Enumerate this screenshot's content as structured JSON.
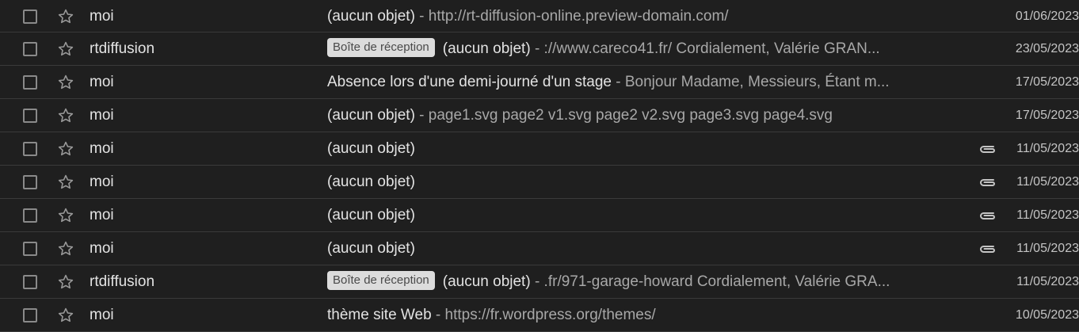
{
  "emails": [
    {
      "sender": "moi",
      "badge": "",
      "subject": "(aucun objet)",
      "snippet": " - http://rt-diffusion-online.preview-domain.com/",
      "attachment": false,
      "date": "01/06/2023"
    },
    {
      "sender": "rtdiffusion",
      "badge": "Boîte de réception",
      "subject": "(aucun objet)",
      "snippet": " - ://www.careco41.fr/ Cordialement, Valérie GRAN...",
      "attachment": false,
      "date": "23/05/2023"
    },
    {
      "sender": "moi",
      "badge": "",
      "subject": "Absence lors d'une demi-journé d'un stage",
      "snippet": " - Bonjour Madame, Messieurs, Étant m...",
      "attachment": false,
      "date": "17/05/2023"
    },
    {
      "sender": "moi",
      "badge": "",
      "subject": "(aucun objet)",
      "snippet": " - page1.svg page2 v1.svg page2 v2.svg page3.svg page4.svg",
      "attachment": false,
      "date": "17/05/2023"
    },
    {
      "sender": "moi",
      "badge": "",
      "subject": "(aucun objet)",
      "snippet": "",
      "attachment": true,
      "date": "11/05/2023"
    },
    {
      "sender": "moi",
      "badge": "",
      "subject": "(aucun objet)",
      "snippet": "",
      "attachment": true,
      "date": "11/05/2023"
    },
    {
      "sender": "moi",
      "badge": "",
      "subject": "(aucun objet)",
      "snippet": "",
      "attachment": true,
      "date": "11/05/2023"
    },
    {
      "sender": "moi",
      "badge": "",
      "subject": "(aucun objet)",
      "snippet": "",
      "attachment": true,
      "date": "11/05/2023"
    },
    {
      "sender": "rtdiffusion",
      "badge": "Boîte de réception",
      "subject": "(aucun objet)",
      "snippet": " - .fr/971-garage-howard Cordialement, Valérie GRA...",
      "attachment": false,
      "date": "11/05/2023"
    },
    {
      "sender": "moi",
      "badge": "",
      "subject": "thème site Web",
      "snippet": " - https://fr.wordpress.org/themes/",
      "attachment": false,
      "date": "10/05/2023"
    }
  ],
  "icons": {
    "checkbox": "checkbox-icon",
    "star": "star-outline-icon",
    "attachment": "paperclip-icon"
  },
  "colors": {
    "background": "#1f1f1f",
    "divider": "#3a3a3a",
    "text": "#e3e3e3",
    "snippet": "#a8a8a8",
    "badge_bg": "#dcdcdc"
  }
}
